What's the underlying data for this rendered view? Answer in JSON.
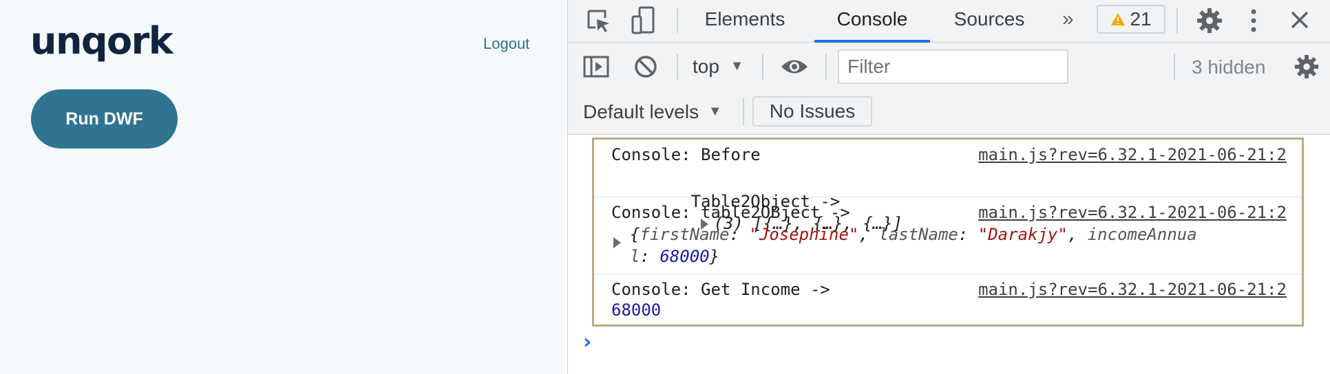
{
  "app": {
    "logo": "unqork",
    "logout_label": "Logout",
    "run_button_label": "Run DWF"
  },
  "devtools": {
    "tabs": [
      {
        "label": "Elements"
      },
      {
        "label": "Console",
        "active": true
      },
      {
        "label": "Sources"
      }
    ],
    "more_tabs_glyph": "»",
    "warning_count": "21",
    "context": "top",
    "filter_placeholder": "Filter",
    "hidden_count": "3 hidden",
    "levels_label": "Default levels",
    "issues_label": "No Issues",
    "accent_color": "#1a73e8",
    "messages": [
      {
        "text": "Console: Before",
        "source": "main.js?rev=6.32.1-2021-06-21:2",
        "line2_label": "Table2Object ->",
        "line2_value": "(3) [{…}, {…}, {…}]"
      },
      {
        "text": "Console: table2OBject ->",
        "source": "main.js?rev=6.32.1-2021-06-21:2",
        "object": {
          "k1": "firstName",
          "v1": "\"Josephine\"",
          "k2": "lastName",
          "v2": "\"Darakjy\"",
          "k3a": "incomeAnnua",
          "k3b": "l",
          "v3": "68000"
        }
      },
      {
        "text": "Console: Get Income ->",
        "source": "main.js?rev=6.32.1-2021-06-21:2",
        "value": "68000"
      }
    ],
    "prompt_glyph": "›"
  }
}
